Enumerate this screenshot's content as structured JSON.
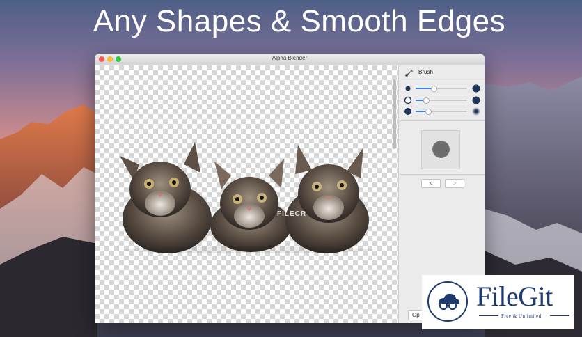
{
  "headline": "Any Shapes & Smooth Edges",
  "window": {
    "title": "Alpha Blender"
  },
  "canvas": {
    "watermark": "FILECR"
  },
  "panel": {
    "tool_label": "Brush",
    "tool_icon": "brush-icon",
    "sliders": [
      {
        "name": "size",
        "value": 0.35
      },
      {
        "name": "hardness",
        "value": 0.2
      },
      {
        "name": "opacity",
        "value": 0.24
      }
    ],
    "prev_label": "<",
    "next_label": ">",
    "open_label": "Op"
  },
  "filegit": {
    "name": "FileGit",
    "tagline": "Free & Unlimited"
  },
  "colors": {
    "slider_fill": "#3b83e0",
    "panel_dot": "#1c3558",
    "filegit_blue": "#1e3a6e"
  }
}
